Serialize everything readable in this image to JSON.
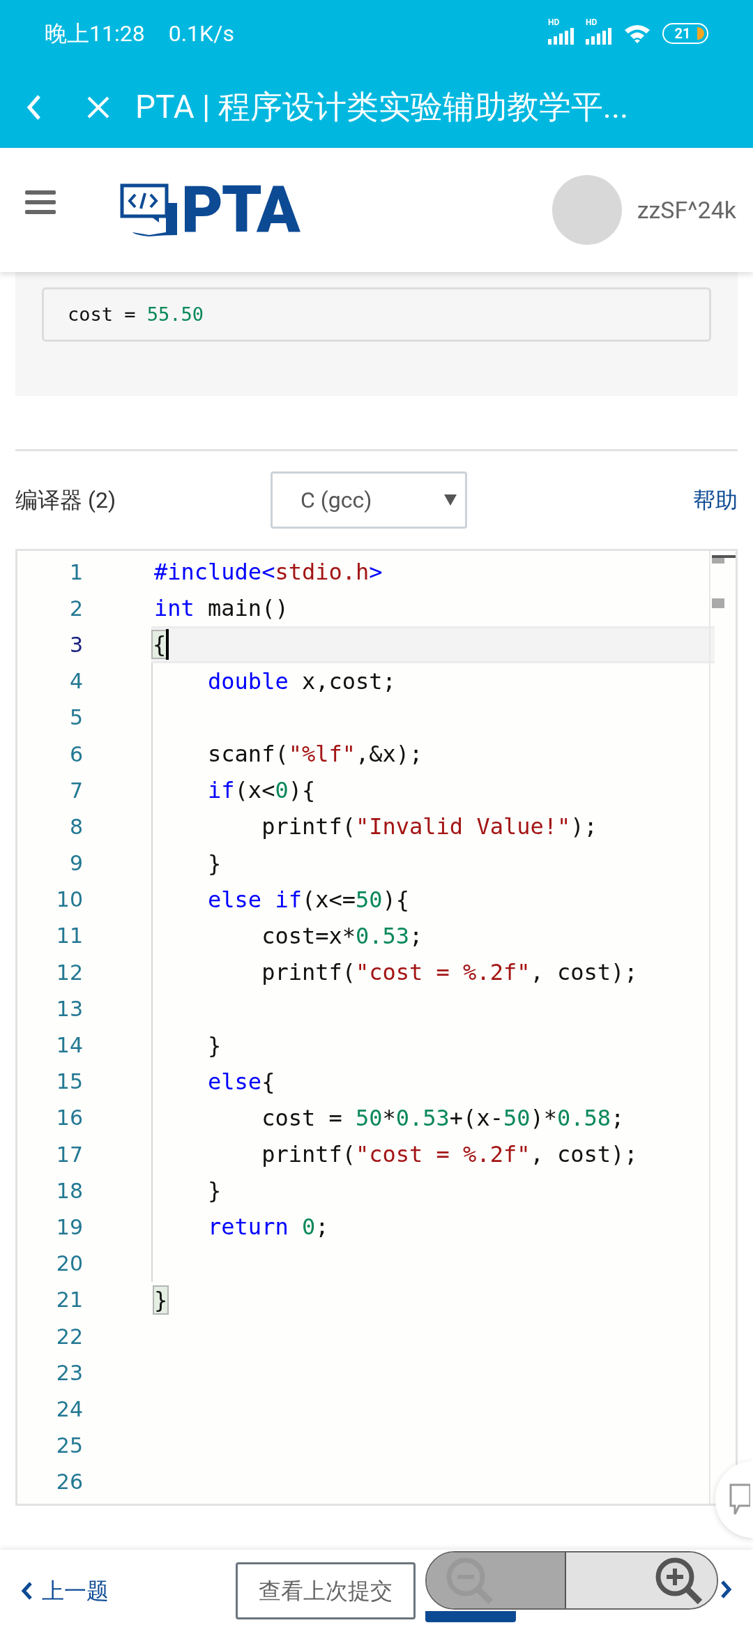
{
  "status_bar": {
    "time": "晚上11:28",
    "speed": "0.1K/s",
    "signals": [
      "HD",
      "HD"
    ],
    "battery": "21"
  },
  "browser_bar": {
    "title": "PTA | 程序设计类实验辅助教学平..."
  },
  "header": {
    "logo": "PTA",
    "username": "zzSF^24k"
  },
  "sample_output": [
    {
      "t": "cost = ",
      "kind": "plain"
    },
    {
      "t": "55.50",
      "kind": "num"
    }
  ],
  "compiler": {
    "label": "编译器 (2)",
    "value": "C (gcc)",
    "help": "帮助"
  },
  "editor": {
    "lines": [
      {
        "n": "1",
        "selected": false,
        "tokens": [
          {
            "t": "#include<",
            "kind": "kw"
          },
          {
            "t": "stdio.h",
            "kind": "str"
          },
          {
            "t": ">",
            "kind": "kw"
          }
        ]
      },
      {
        "n": "2",
        "selected": false,
        "tokens": [
          {
            "t": "int",
            "kind": "kw"
          },
          {
            "t": " main()",
            "kind": "plain"
          }
        ]
      },
      {
        "n": "3",
        "selected": true,
        "tokens": [
          {
            "t": "{",
            "kind": "match"
          }
        ]
      },
      {
        "n": "4",
        "selected": false,
        "tokens": [
          {
            "t": "    double",
            "kind": "kw"
          },
          {
            "t": " x,cost;",
            "kind": "plain"
          }
        ]
      },
      {
        "n": "5",
        "selected": false
      },
      {
        "n": "6",
        "selected": false,
        "tokens": [
          {
            "t": "    scanf(",
            "kind": "plain"
          },
          {
            "t": "\"%lf\"",
            "kind": "str"
          },
          {
            "t": ",&x);",
            "kind": "plain"
          }
        ]
      },
      {
        "n": "7",
        "selected": false,
        "tokens": [
          {
            "t": "    if",
            "kind": "kw"
          },
          {
            "t": "(x<",
            "kind": "plain"
          },
          {
            "t": "0",
            "kind": "num"
          },
          {
            "t": "){",
            "kind": "plain"
          }
        ]
      },
      {
        "n": "8",
        "selected": false,
        "tokens": [
          {
            "t": "        printf(",
            "kind": "plain"
          },
          {
            "t": "\"Invalid Value!\"",
            "kind": "str"
          },
          {
            "t": ");",
            "kind": "plain"
          }
        ]
      },
      {
        "n": "9",
        "selected": false,
        "tokens": [
          {
            "t": "    }",
            "kind": "plain"
          }
        ]
      },
      {
        "n": "10",
        "selected": false,
        "tokens": [
          {
            "t": "    else if",
            "kind": "kw"
          },
          {
            "t": "(x<=",
            "kind": "plain"
          },
          {
            "t": "50",
            "kind": "num"
          },
          {
            "t": "){",
            "kind": "plain"
          }
        ]
      },
      {
        "n": "11",
        "selected": false,
        "tokens": [
          {
            "t": "        cost=x*",
            "kind": "plain"
          },
          {
            "t": "0.53",
            "kind": "num"
          },
          {
            "t": ";",
            "kind": "plain"
          }
        ]
      },
      {
        "n": "12",
        "selected": false,
        "tokens": [
          {
            "t": "        printf(",
            "kind": "plain"
          },
          {
            "t": "\"cost = %.2f\"",
            "kind": "str"
          },
          {
            "t": ", cost);",
            "kind": "plain"
          }
        ]
      },
      {
        "n": "13",
        "selected": false
      },
      {
        "n": "14",
        "selected": false,
        "tokens": [
          {
            "t": "    }",
            "kind": "plain"
          }
        ]
      },
      {
        "n": "15",
        "selected": false,
        "tokens": [
          {
            "t": "    else",
            "kind": "kw"
          },
          {
            "t": "{",
            "kind": "plain"
          }
        ]
      },
      {
        "n": "16",
        "selected": false,
        "tokens": [
          {
            "t": "        cost = ",
            "kind": "plain"
          },
          {
            "t": "50",
            "kind": "num"
          },
          {
            "t": "*",
            "kind": "plain"
          },
          {
            "t": "0.53",
            "kind": "num"
          },
          {
            "t": "+(x-",
            "kind": "plain"
          },
          {
            "t": "50",
            "kind": "num"
          },
          {
            "t": ")*",
            "kind": "plain"
          },
          {
            "t": "0.58",
            "kind": "num"
          },
          {
            "t": ";",
            "kind": "plain"
          }
        ]
      },
      {
        "n": "17",
        "selected": false,
        "tokens": [
          {
            "t": "        printf(",
            "kind": "plain"
          },
          {
            "t": "\"cost = %.2f\"",
            "kind": "str"
          },
          {
            "t": ", cost);",
            "kind": "plain"
          }
        ]
      },
      {
        "n": "18",
        "selected": false,
        "tokens": [
          {
            "t": "    }",
            "kind": "plain"
          }
        ]
      },
      {
        "n": "19",
        "selected": false,
        "tokens": [
          {
            "t": "    return",
            "kind": "kw"
          },
          {
            "t": " 0",
            "kind": "num"
          },
          {
            "t": ";",
            "kind": "plain"
          }
        ]
      },
      {
        "n": "20",
        "selected": false
      },
      {
        "n": "21",
        "selected": false,
        "tokens": [
          {
            "t": "}",
            "kind": "match"
          }
        ]
      },
      {
        "n": "22",
        "selected": false
      },
      {
        "n": "23",
        "selected": false
      },
      {
        "n": "24",
        "selected": false
      },
      {
        "n": "25",
        "selected": false
      },
      {
        "n": "26",
        "selected": false
      }
    ]
  },
  "footer": {
    "prev": "上一题",
    "last_submit": "查看上次提交"
  }
}
